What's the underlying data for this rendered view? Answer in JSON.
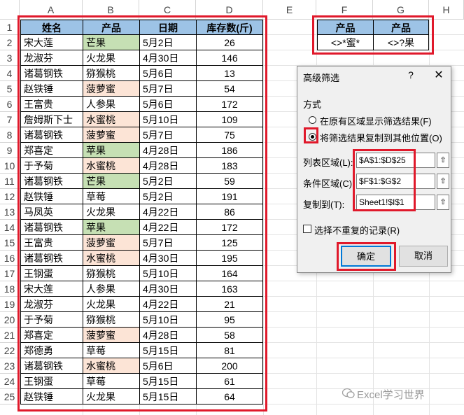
{
  "columns": [
    "A",
    "B",
    "C",
    "D",
    "E",
    "F",
    "G",
    "H"
  ],
  "row_numbers": [
    "1",
    "2",
    "3",
    "4",
    "5",
    "6",
    "7",
    "8",
    "9",
    "10",
    "11",
    "12",
    "13",
    "14",
    "15",
    "16",
    "17",
    "18",
    "19",
    "20",
    "21",
    "22",
    "23",
    "24",
    "25"
  ],
  "table": {
    "headers": [
      "姓名",
      "产品",
      "日期",
      "库存数(斤)"
    ],
    "rows": [
      {
        "name": "宋大莲",
        "product": "芒果",
        "date": "5月2日",
        "qty": "26",
        "hl": "green"
      },
      {
        "name": "龙淑芬",
        "product": "火龙果",
        "date": "4月30日",
        "qty": "146",
        "hl": ""
      },
      {
        "name": "诸葛钢铁",
        "product": "猕猴桃",
        "date": "5月6日",
        "qty": "13",
        "hl": ""
      },
      {
        "name": "赵铁锤",
        "product": "菠萝蜜",
        "date": "5月7日",
        "qty": "54",
        "hl": "pink"
      },
      {
        "name": "王富贵",
        "product": "人参果",
        "date": "5月6日",
        "qty": "172",
        "hl": ""
      },
      {
        "name": "詹姆斯下士",
        "product": "水蜜桃",
        "date": "5月10日",
        "qty": "109",
        "hl": "pink"
      },
      {
        "name": "诸葛钢铁",
        "product": "菠萝蜜",
        "date": "5月7日",
        "qty": "75",
        "hl": "pink"
      },
      {
        "name": "郑喜定",
        "product": "苹果",
        "date": "4月28日",
        "qty": "186",
        "hl": "green"
      },
      {
        "name": "于予菊",
        "product": "水蜜桃",
        "date": "4月28日",
        "qty": "183",
        "hl": "pink"
      },
      {
        "name": "诸葛钢铁",
        "product": "芒果",
        "date": "5月2日",
        "qty": "59",
        "hl": "green"
      },
      {
        "name": "赵铁锤",
        "product": "草莓",
        "date": "5月2日",
        "qty": "191",
        "hl": ""
      },
      {
        "name": "马凤英",
        "product": "火龙果",
        "date": "4月22日",
        "qty": "86",
        "hl": ""
      },
      {
        "name": "诸葛钢铁",
        "product": "苹果",
        "date": "4月22日",
        "qty": "172",
        "hl": "green"
      },
      {
        "name": "王富贵",
        "product": "菠萝蜜",
        "date": "5月7日",
        "qty": "125",
        "hl": "pink"
      },
      {
        "name": "诸葛钢铁",
        "product": "水蜜桃",
        "date": "4月30日",
        "qty": "195",
        "hl": "pink"
      },
      {
        "name": "王钢蛋",
        "product": "猕猴桃",
        "date": "5月10日",
        "qty": "164",
        "hl": ""
      },
      {
        "name": "宋大莲",
        "product": "人参果",
        "date": "4月30日",
        "qty": "163",
        "hl": ""
      },
      {
        "name": "龙淑芬",
        "product": "火龙果",
        "date": "4月22日",
        "qty": "21",
        "hl": ""
      },
      {
        "name": "于予菊",
        "product": "猕猴桃",
        "date": "5月10日",
        "qty": "95",
        "hl": ""
      },
      {
        "name": "郑喜定",
        "product": "菠萝蜜",
        "date": "4月28日",
        "qty": "58",
        "hl": "pink"
      },
      {
        "name": "郑德勇",
        "product": "草莓",
        "date": "5月15日",
        "qty": "81",
        "hl": ""
      },
      {
        "name": "诸葛钢铁",
        "product": "水蜜桃",
        "date": "5月6日",
        "qty": "200",
        "hl": "pink"
      },
      {
        "name": "王钢蛋",
        "product": "草莓",
        "date": "5月15日",
        "qty": "61",
        "hl": ""
      },
      {
        "name": "赵铁锤",
        "product": "火龙果",
        "date": "5月15日",
        "qty": "64",
        "hl": ""
      }
    ]
  },
  "criteria": {
    "headers": [
      "产品",
      "产品"
    ],
    "values": [
      "<>*蜜*",
      "<>?果"
    ]
  },
  "dialog": {
    "title": "高级筛选",
    "help": "?",
    "close": "✕",
    "section_label": "方式",
    "radio_in_place": "在原有区域显示筛选结果(F)",
    "radio_copy": "将筛选结果复制到其他位置(O)",
    "list_range_label": "列表区域(L):",
    "list_range_value": "$A$1:$D$25",
    "criteria_range_label": "条件区域(C):",
    "criteria_range_value": "$F$1:$G$2",
    "copy_to_label": "复制到(T):",
    "copy_to_value": "Sheet1!$I$1",
    "unique_label": "选择不重复的记录(R)",
    "ok_label": "确定",
    "cancel_label": "取消"
  },
  "watermark": "Excel学习世界",
  "colors": {
    "header_blue": "#9dc3e6",
    "green_fill": "#c6e0b4",
    "pink_fill": "#fce4d6",
    "highlight_red": "#e0192b"
  }
}
